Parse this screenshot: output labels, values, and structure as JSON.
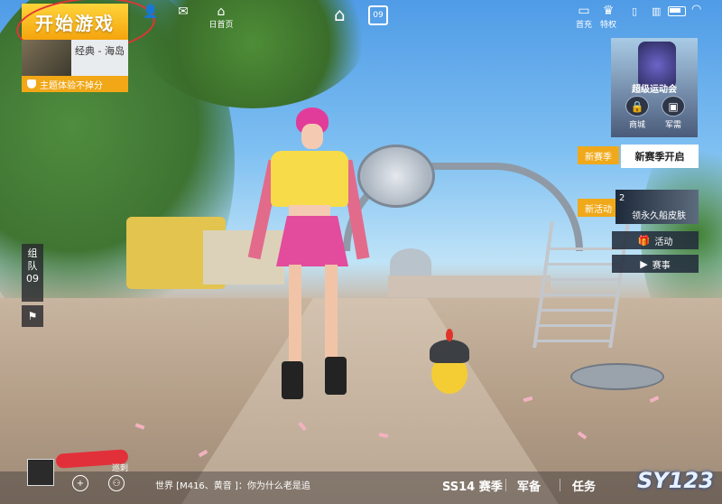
{
  "header": {
    "start_game": "开始游戏",
    "mode_label": "经典 - 海岛",
    "theme_note": "主题体验不掉分",
    "icons_left": [
      {
        "label": "",
        "icon": "person-icon"
      },
      {
        "label": "",
        "icon": "chat-icon"
      },
      {
        "label": "日首页",
        "icon": "mail-icon"
      }
    ],
    "calendar_num": "09",
    "recharge": "首充",
    "privilege": "特权",
    "wifi_icon": "wifi-icon"
  },
  "right_panel": {
    "promo_title": "超级运动会",
    "shop": "商城",
    "military": "军需",
    "new_season_tag": "新赛季",
    "new_season_text": "新赛季开启",
    "new_event_tag": "新活动",
    "event_num": "2",
    "event_text": "领永久船皮肤",
    "activity": "活动",
    "match": "赛事"
  },
  "left_panel": {
    "team_line1": "组",
    "team_line2": "队",
    "team_count": "09"
  },
  "bottom": {
    "user_tag": "巡刺",
    "chat_text": "世界 [M416、黄音 ]：你为什么老是追",
    "nav": [
      {
        "label": "SS14 赛季"
      },
      {
        "label": "军备"
      },
      {
        "label": "任务"
      }
    ],
    "watermark": "SY123"
  }
}
